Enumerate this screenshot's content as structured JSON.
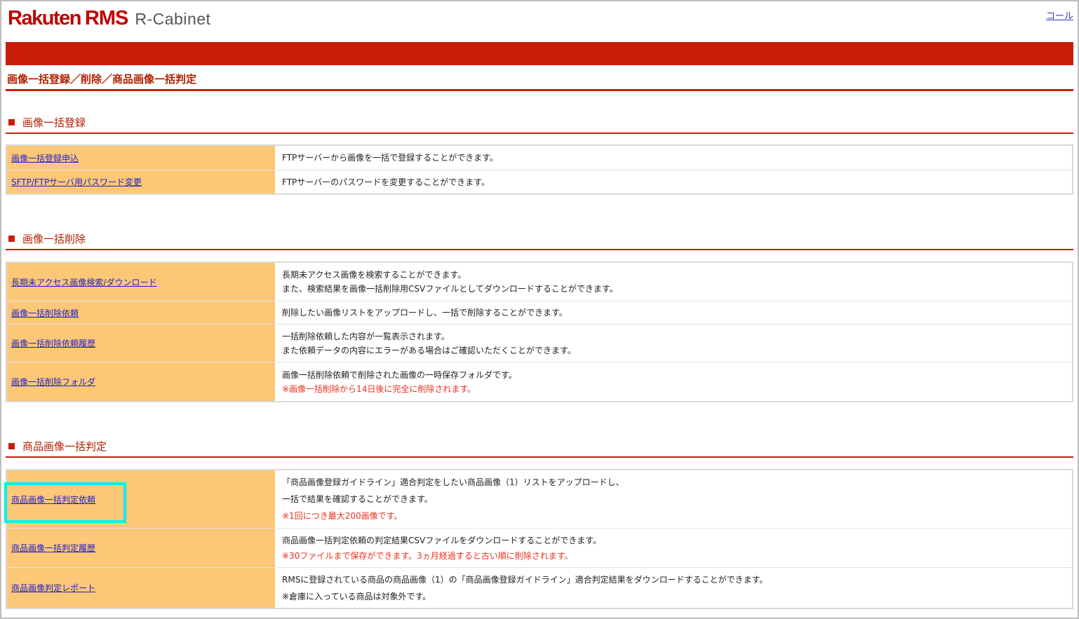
{
  "header": {
    "logo_rakuten": "Rakuten",
    "logo_rms": "RMS",
    "logo_cabinet": "R-Cabinet",
    "top_link": "コール"
  },
  "page_title": "画像一括登録／削除／商品画像一括判定",
  "sections": [
    {
      "heading": "画像一括登録",
      "rows": [
        {
          "link": "画像一括登録申込",
          "lines": [
            "FTPサーバーから画像を一括で登録することができます。"
          ]
        },
        {
          "link": "SFTP/FTPサーバ用パスワード変更",
          "lines": [
            "FTPサーバーのパスワードを変更することができます。"
          ]
        }
      ]
    },
    {
      "heading": "画像一括削除",
      "rows": [
        {
          "link": "長期未アクセス画像検索/ダウンロード",
          "lines": [
            "長期未アクセス画像を検索することができます。",
            "また、検索結果を画像一括削除用CSVファイルとしてダウンロードすることができます。"
          ]
        },
        {
          "link": "画像一括削除依頼",
          "lines": [
            "削除したい画像リストをアップロードし、一括で削除することができます。"
          ]
        },
        {
          "link": "画像一括削除依頼履歴",
          "lines": [
            "一括削除依頼した内容が一覧表示されます。",
            "また依頼データの内容にエラーがある場合はご確認いただくことができます。"
          ]
        },
        {
          "link": "画像一括削除フォルダ",
          "lines": [
            "画像一括削除依頼で削除された画像の一時保存フォルダです。"
          ],
          "note": "※画像一括削除から14日後に完全に削除されます。"
        }
      ]
    },
    {
      "heading": "商品画像一括判定",
      "rows": [
        {
          "link": "商品画像一括判定依頼",
          "lines": [
            "「商品画像登録ガイドライン」適合判定をしたい商品画像（1）リストをアップロードし、",
            "一括で結果を確認することができます。"
          ],
          "note": "※1回につき最大200画像です。"
        },
        {
          "link": "商品画像一括判定履歴",
          "lines": [
            "商品画像一括判定依頼の判定結果CSVファイルをダウンロードすることができます。"
          ],
          "note": "※30ファイルまで保存ができます。3ヵ月経過すると古い順に削除されます。"
        },
        {
          "link": "商品画像判定レポート",
          "lines": [
            "RMSに登録されている商品の商品画像（1）の「商品画像登録ガイドライン」適合判定結果をダウンロードすることができます。",
            "※倉庫に入っている商品は対象外です。"
          ]
        }
      ]
    }
  ],
  "colors": {
    "brand_red": "#c81e0a",
    "link_cell_bg": "#fcc776",
    "link": "#2222cc",
    "note": "#e8301c",
    "highlight": "#00f0f0"
  }
}
